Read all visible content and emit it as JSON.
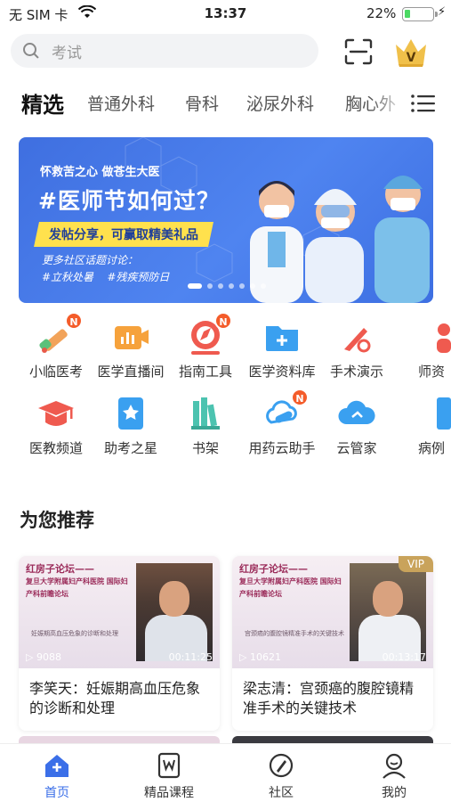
{
  "status_bar": {
    "carrier": "无 SIM 卡",
    "time": "13:37",
    "battery_percent": "22%",
    "battery_level": 0.22
  },
  "search": {
    "placeholder": "考试"
  },
  "tabs": [
    {
      "label": "精选",
      "active": true
    },
    {
      "label": "普通外科"
    },
    {
      "label": "骨科"
    },
    {
      "label": "泌尿外科"
    },
    {
      "label": "胸心外"
    }
  ],
  "banner": {
    "slogan": "怀救苦之心 做苍生大医",
    "headline": "#医师节如何过？",
    "ribbon": "发帖分享，可赢取精美礼品",
    "more_topics": "更多社区话题讨论：",
    "tags": "#立秋处暑    #残疾预防日",
    "slides": 7,
    "active_slide": 0
  },
  "tools": [
    {
      "label": "小临医考",
      "icon": "pen-icon",
      "badge": "N"
    },
    {
      "label": "医学直播间",
      "icon": "live-chart-icon"
    },
    {
      "label": "指南工具",
      "icon": "compass-icon",
      "badge": "N"
    },
    {
      "label": "医学资料库",
      "icon": "folder-plus-icon"
    },
    {
      "label": "手术演示",
      "icon": "scalpel-icon"
    },
    {
      "label": "师资",
      "icon": "teacher-icon"
    },
    {
      "label": "医教频道",
      "icon": "graduation-cap-icon"
    },
    {
      "label": "助考之星",
      "icon": "star-book-icon"
    },
    {
      "label": "书架",
      "icon": "bookshelf-icon"
    },
    {
      "label": "用药云助手",
      "icon": "pill-cloud-icon",
      "badge": "N"
    },
    {
      "label": "云管家",
      "icon": "cloud-icon"
    },
    {
      "label": "病例",
      "icon": "case-icon"
    }
  ],
  "recommend": {
    "title": "为您推荐",
    "cards": [
      {
        "title": "李笑天：妊娠期高血压危象的诊断和处理",
        "forum": "红房子论坛——",
        "forum_sub": "复旦大学附属妇产科医院 国际妇产科前瞻论坛",
        "talk": "妊娠期高血压危象的诊断和处理",
        "views": "9088",
        "duration": "00:11:25",
        "vip": false
      },
      {
        "title": "梁志清：宫颈癌的腹腔镜精准手术的关键技术",
        "forum": "红房子论坛——",
        "forum_sub": "复旦大学附属妇产科医院 国际妇产科前瞻论坛",
        "talk": "宫颈癌的腹腔镜精准手术的关键技术",
        "views": "10621",
        "duration": "00:13:17",
        "vip": true,
        "vip_label": "VIP"
      }
    ]
  },
  "bottom_nav": [
    {
      "label": "首页",
      "icon": "home-icon",
      "active": true
    },
    {
      "label": "精品课程",
      "icon": "course-icon"
    },
    {
      "label": "社区",
      "icon": "community-icon"
    },
    {
      "label": "我的",
      "icon": "profile-icon"
    }
  ],
  "colors": {
    "accent": "#3b6fe8",
    "badge": "#f45c2a",
    "vip": "#c9a35b"
  }
}
